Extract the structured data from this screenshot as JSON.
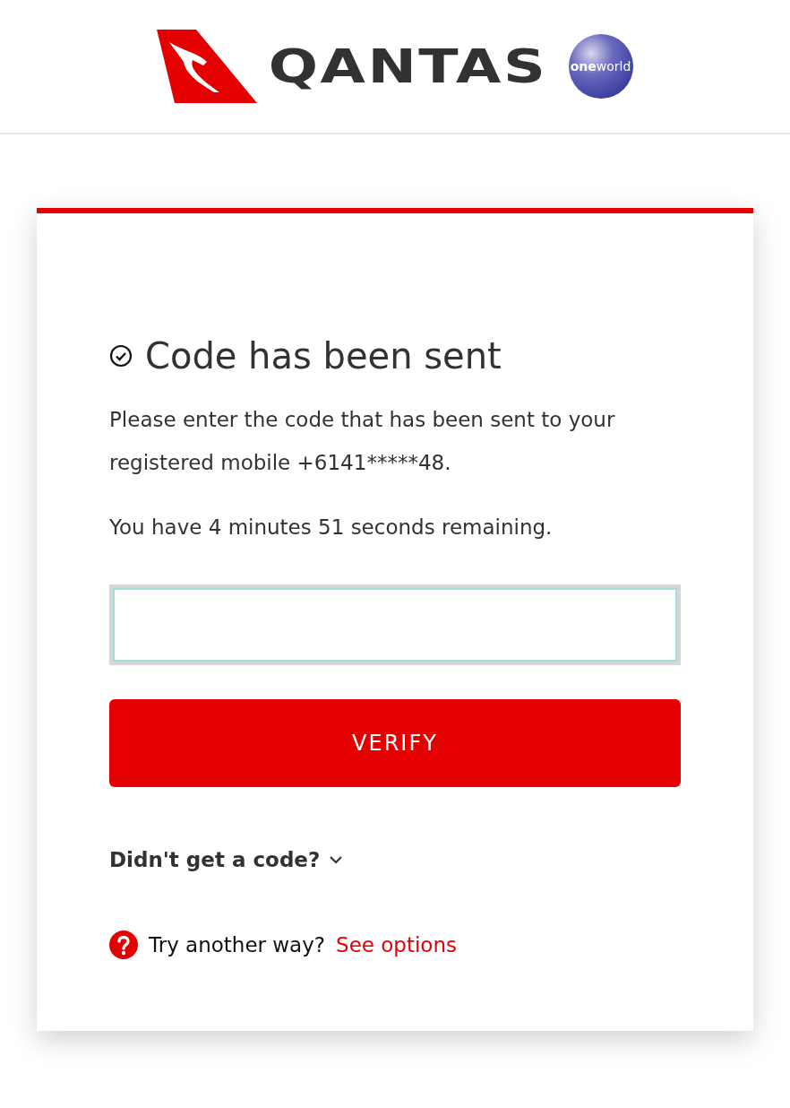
{
  "header": {
    "brand": "QANTAS",
    "alliance": "**one**world"
  },
  "card": {
    "title": "Code has been sent",
    "message": "Please enter the code that has been sent to your registered mobile +6141*****48.",
    "timer": "You have 4 minutes 51 seconds remaining.",
    "verify_button": "VERIFY",
    "no_code": {
      "label": "Didn't get a code?",
      "expanded": false
    },
    "help": {
      "text": "Try another way?",
      "link": "See options"
    }
  }
}
